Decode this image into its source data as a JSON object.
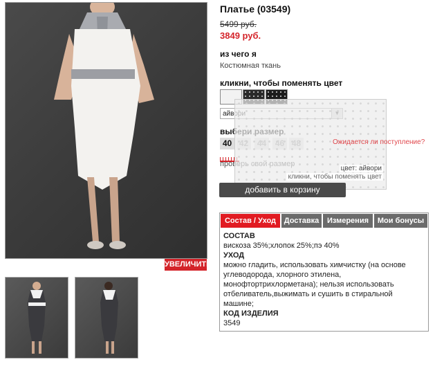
{
  "product": {
    "title": "Платье (03549)",
    "old_price": "5499 руб.",
    "new_price": "3849 руб."
  },
  "gallery": {
    "zoom_label": "УВЕЛИЧИТЬ"
  },
  "material": {
    "label": "из чего я",
    "value": "Костюмная ткань"
  },
  "color": {
    "label": "кликни, чтобы поменять цвет",
    "selected": "айвори",
    "swatch_colors": [
      "#f2f2f2",
      "#2a2a2a",
      "#1c1c1c"
    ]
  },
  "size": {
    "label": "выбери размер",
    "options": [
      "40",
      "42",
      "44",
      "46",
      "48"
    ],
    "selected": "40",
    "check_label": "проверь свой размер",
    "waiting_link": "Ожидается ли поступление?"
  },
  "overlay": {
    "caption_color": "цвет: айвори",
    "caption_hint": "кликни, чтобы поменять цвет"
  },
  "cart": {
    "button_label": "добавить в корзину"
  },
  "tabs": {
    "items": [
      "Состав / Уход",
      "Доставка",
      "Измерения",
      "Мои бонусы"
    ],
    "active": "Состав / Уход",
    "content": {
      "composition_heading": "СОСТАВ",
      "composition_text": "вискоза 35%;хлопок 25%;пэ 40%",
      "care_heading": "УХОД",
      "care_text": "можно гладить, использовать химчистку (на основе углеводорода, хлорного этилена, монофтортрихлорметана); нельзя использовать отбеливатель,выжимать и сушить в стиральной машине;",
      "code_heading": "КОД ИЗДЕЛИЯ",
      "code_value": "3549"
    }
  },
  "colors": {
    "accent": "#e11b22",
    "tab_inactive": "#6b6b6b",
    "button": "#4a4a4a"
  }
}
